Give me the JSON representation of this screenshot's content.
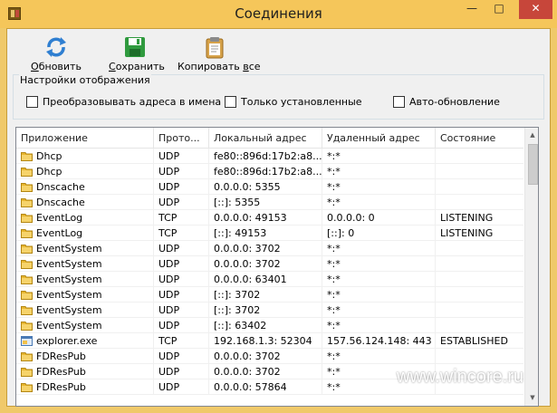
{
  "window": {
    "title": "Соединения",
    "minimize_glyph": "—",
    "maximize_glyph": "□",
    "close_glyph": "✕"
  },
  "toolbar": {
    "refresh_label_u": "О",
    "refresh_label_rest": "бновить",
    "save_label_u": "С",
    "save_label_rest": "охранить",
    "copy_label_rest": "Копировать ",
    "copy_label_u": "в",
    "copy_label_tail": "се"
  },
  "display_settings": {
    "title": "Настройки отображения",
    "resolve_names": "Преобразовывать адреса в имена",
    "established_only": "Только установленные",
    "auto_refresh": "Авто-обновление"
  },
  "table": {
    "columns": [
      "Приложение",
      "Прото...",
      "Локальный адрес",
      "Удаленный адрес",
      "Состояние"
    ],
    "rows": [
      {
        "app": "Dhcp",
        "icon": "folder-icon",
        "proto": "UDP",
        "local": "fe80::896d:17b2:a8...",
        "remote": "*:*",
        "state": ""
      },
      {
        "app": "Dhcp",
        "icon": "folder-icon",
        "proto": "UDP",
        "local": "fe80::896d:17b2:a8...",
        "remote": "*:*",
        "state": ""
      },
      {
        "app": "Dnscache",
        "icon": "folder-icon",
        "proto": "UDP",
        "local": "0.0.0.0: 5355",
        "remote": "*:*",
        "state": ""
      },
      {
        "app": "Dnscache",
        "icon": "folder-icon",
        "proto": "UDP",
        "local": "[::]: 5355",
        "remote": "*:*",
        "state": ""
      },
      {
        "app": "EventLog",
        "icon": "folder-icon",
        "proto": "TCP",
        "local": "0.0.0.0: 49153",
        "remote": "0.0.0.0: 0",
        "state": "LISTENING"
      },
      {
        "app": "EventLog",
        "icon": "folder-icon",
        "proto": "TCP",
        "local": "[::]: 49153",
        "remote": "[::]: 0",
        "state": "LISTENING"
      },
      {
        "app": "EventSystem",
        "icon": "folder-icon",
        "proto": "UDP",
        "local": "0.0.0.0: 3702",
        "remote": "*:*",
        "state": ""
      },
      {
        "app": "EventSystem",
        "icon": "folder-icon",
        "proto": "UDP",
        "local": "0.0.0.0: 3702",
        "remote": "*:*",
        "state": ""
      },
      {
        "app": "EventSystem",
        "icon": "folder-icon",
        "proto": "UDP",
        "local": "0.0.0.0: 63401",
        "remote": "*:*",
        "state": ""
      },
      {
        "app": "EventSystem",
        "icon": "folder-icon",
        "proto": "UDP",
        "local": "[::]: 3702",
        "remote": "*:*",
        "state": ""
      },
      {
        "app": "EventSystem",
        "icon": "folder-icon",
        "proto": "UDP",
        "local": "[::]: 3702",
        "remote": "*:*",
        "state": ""
      },
      {
        "app": "EventSystem",
        "icon": "folder-icon",
        "proto": "UDP",
        "local": "[::]: 63402",
        "remote": "*:*",
        "state": ""
      },
      {
        "app": "explorer.exe",
        "icon": "application-icon",
        "proto": "TCP",
        "local": "192.168.1.3: 52304",
        "remote": "157.56.124.148: 443",
        "state": "ESTABLISHED"
      },
      {
        "app": "FDResPub",
        "icon": "folder-icon",
        "proto": "UDP",
        "local": "0.0.0.0: 3702",
        "remote": "*:*",
        "state": ""
      },
      {
        "app": "FDResPub",
        "icon": "folder-icon",
        "proto": "UDP",
        "local": "0.0.0.0: 3702",
        "remote": "*:*",
        "state": ""
      },
      {
        "app": "FDResPub",
        "icon": "folder-icon",
        "proto": "UDP",
        "local": "0.0.0.0: 57864",
        "remote": "*:*",
        "state": ""
      }
    ]
  },
  "watermark": "www.wincore.ru",
  "colors": {
    "title_bar": "#f5c65a",
    "close_button": "#c7463a",
    "window_bg": "#f0f0f0"
  }
}
